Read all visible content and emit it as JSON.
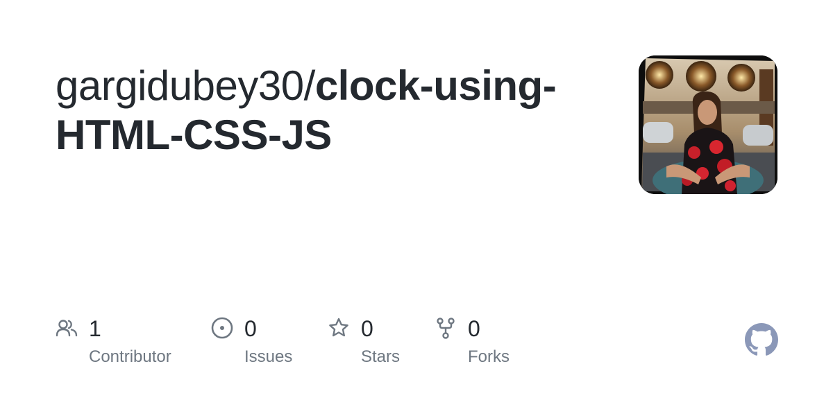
{
  "repo": {
    "owner": "gargidubey30/",
    "name": "clock-using-HTML-CSS-JS"
  },
  "stats": [
    {
      "icon": "people-icon",
      "count": "1",
      "label": "Contributor"
    },
    {
      "icon": "issue-opened-icon",
      "count": "0",
      "label": "Issues"
    },
    {
      "icon": "star-icon",
      "count": "0",
      "label": "Stars"
    },
    {
      "icon": "repo-forked-icon",
      "count": "0",
      "label": "Forks"
    }
  ],
  "colors": {
    "text": "#24292f",
    "muted": "#6e7781",
    "github_logo": "#8b98b8"
  }
}
